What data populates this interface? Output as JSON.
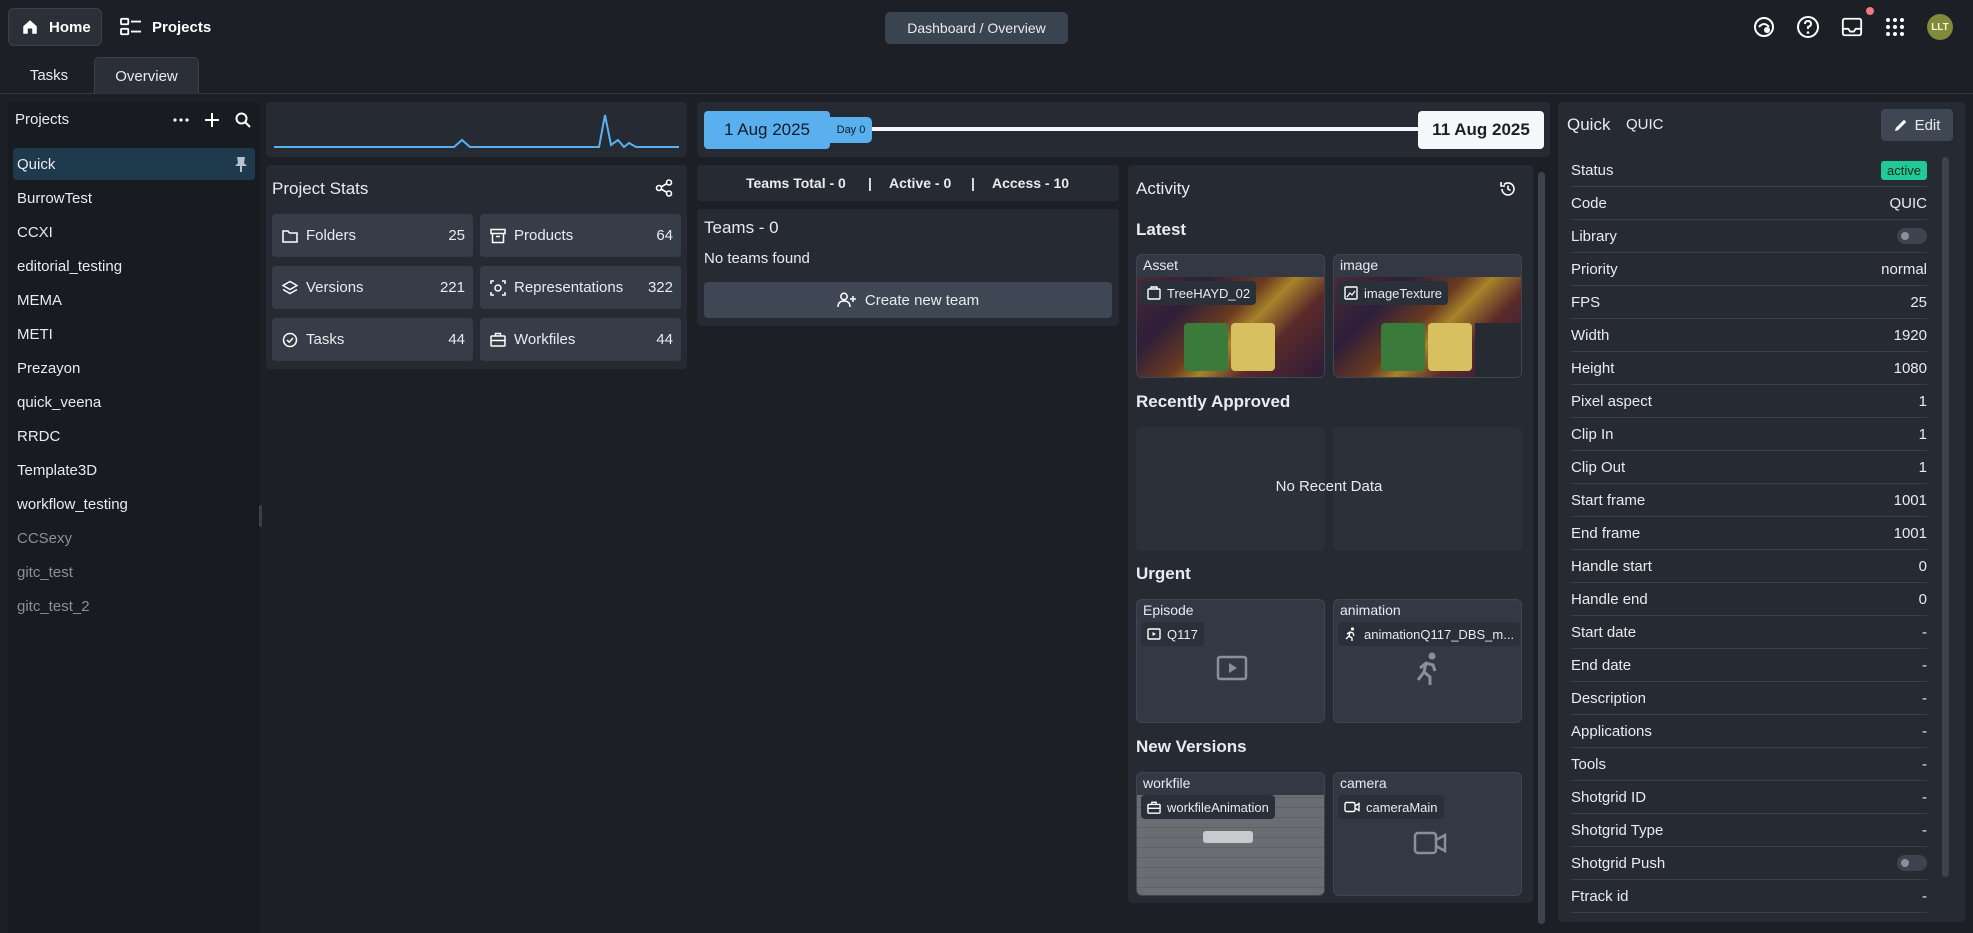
{
  "header": {
    "home_label": "Home",
    "projects_label": "Projects",
    "breadcrumb": "Dashboard / Overview",
    "avatar_initials": "LLT"
  },
  "tabs": [
    {
      "label": "Tasks"
    },
    {
      "label": "Overview"
    }
  ],
  "sidebar": {
    "title": "Projects",
    "projects": [
      {
        "name": "Quick",
        "active": true
      },
      {
        "name": "BurrowTest"
      },
      {
        "name": "CCXI"
      },
      {
        "name": "editorial_testing"
      },
      {
        "name": "MEMA"
      },
      {
        "name": "METI"
      },
      {
        "name": "Prezayon"
      },
      {
        "name": "quick_veena"
      },
      {
        "name": "RRDC"
      },
      {
        "name": "Template3D"
      },
      {
        "name": "workflow_testing"
      },
      {
        "name": "CCSexy",
        "inactive": true
      },
      {
        "name": "gitc_test",
        "inactive": true
      },
      {
        "name": "gitc_test_2",
        "inactive": true
      }
    ]
  },
  "timeline": {
    "start": "1 Aug 2025",
    "day_badge": "Day 0",
    "end": "11 Aug 2025"
  },
  "project_stats": {
    "title": "Project Stats",
    "items": [
      {
        "label": "Folders",
        "value": "25"
      },
      {
        "label": "Products",
        "value": "64"
      },
      {
        "label": "Versions",
        "value": "221"
      },
      {
        "label": "Representations",
        "value": "322"
      },
      {
        "label": "Tasks",
        "value": "44"
      },
      {
        "label": "Workfiles",
        "value": "44"
      }
    ]
  },
  "teams": {
    "summary_total": "Teams Total - 0",
    "summary_active": "Active - 0",
    "summary_access": "Access - 10",
    "separator": "|",
    "title": "Teams - 0",
    "empty": "No teams found",
    "create_label": "Create new team"
  },
  "activity": {
    "title": "Activity",
    "latest_title": "Latest",
    "latest": [
      {
        "type": "Asset",
        "name": "TreeHAYD_02"
      },
      {
        "type": "image",
        "name": "imageTexture"
      }
    ],
    "approved_title": "Recently Approved",
    "approved_empty": "No Recent Data",
    "urgent_title": "Urgent",
    "urgent": [
      {
        "type": "Episode",
        "name": "Q117"
      },
      {
        "type": "animation",
        "name": "animationQ117_DBS_m..."
      }
    ],
    "versions_title": "New Versions",
    "versions": [
      {
        "type": "workfile",
        "name": "workfileAnimation"
      },
      {
        "type": "camera",
        "name": "cameraMain"
      }
    ]
  },
  "details": {
    "name": "Quick",
    "code": "QUIC",
    "edit_label": "Edit",
    "rows": [
      {
        "label": "Status",
        "value": "active",
        "kind": "badge"
      },
      {
        "label": "Code",
        "value": "QUIC"
      },
      {
        "label": "Library",
        "value": "",
        "kind": "toggle"
      },
      {
        "label": "Priority",
        "value": "normal"
      },
      {
        "label": "FPS",
        "value": "25"
      },
      {
        "label": "Width",
        "value": "1920"
      },
      {
        "label": "Height",
        "value": "1080"
      },
      {
        "label": "Pixel aspect",
        "value": "1"
      },
      {
        "label": "Clip In",
        "value": "1"
      },
      {
        "label": "Clip Out",
        "value": "1"
      },
      {
        "label": "Start frame",
        "value": "1001"
      },
      {
        "label": "End frame",
        "value": "1001"
      },
      {
        "label": "Handle start",
        "value": "0"
      },
      {
        "label": "Handle end",
        "value": "0"
      },
      {
        "label": "Start date",
        "value": "-"
      },
      {
        "label": "End date",
        "value": "-"
      },
      {
        "label": "Description",
        "value": "-"
      },
      {
        "label": "Applications",
        "value": "-"
      },
      {
        "label": "Tools",
        "value": "-"
      },
      {
        "label": "Shotgrid ID",
        "value": "-"
      },
      {
        "label": "Shotgrid Type",
        "value": "-"
      },
      {
        "label": "Shotgrid Push",
        "value": "",
        "kind": "toggle"
      },
      {
        "label": "Ftrack id",
        "value": "-"
      }
    ]
  },
  "colors": {
    "accent": "#5ab0ef",
    "status_active": "#22c996",
    "background": "#1c1f25",
    "panel": "#262b33"
  }
}
